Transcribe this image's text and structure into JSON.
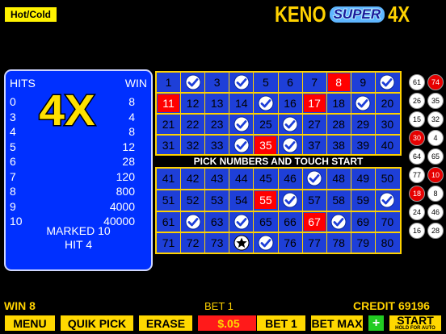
{
  "header": {
    "hotcold_label": "Hot/Cold",
    "logo": {
      "keno": "KENO",
      "super": "SUPER",
      "fx": "4X"
    }
  },
  "paytable": {
    "hits_label": "HITS",
    "win_label": "WIN",
    "badge": "4X",
    "rows": [
      {
        "hits": "0",
        "win": "8"
      },
      {
        "hits": "3",
        "win": "4"
      },
      {
        "hits": "4",
        "win": "8"
      },
      {
        "hits": "5",
        "win": "12"
      },
      {
        "hits": "6",
        "win": "28"
      },
      {
        "hits": "7",
        "win": "120"
      },
      {
        "hits": "8",
        "win": "800"
      },
      {
        "hits": "9",
        "win": "4000"
      },
      {
        "hits": "10",
        "win": "40000"
      }
    ],
    "marked_text": "MARKED 10",
    "hit_text": "HIT 4"
  },
  "board": {
    "pick_message": "PICK NUMBERS AND TOUCH START",
    "checked_numbers": [
      2,
      4,
      10,
      15,
      19,
      24,
      26,
      34,
      36,
      47,
      56,
      60,
      62,
      64,
      68,
      75
    ],
    "red_numbers": [
      8,
      11,
      17,
      35,
      55,
      67
    ],
    "star_numbers": [
      74
    ],
    "colors": {
      "board_bg": "#1e3fd8",
      "grid": "#ffd200",
      "hit_red": "#ff0000"
    }
  },
  "balls": [
    {
      "n": "61",
      "red": false
    },
    {
      "n": "74",
      "red": true
    },
    {
      "n": "26",
      "red": false
    },
    {
      "n": "35",
      "red": false
    },
    {
      "n": "15",
      "red": false
    },
    {
      "n": "32",
      "red": false
    },
    {
      "n": "30",
      "red": true
    },
    {
      "n": "4",
      "red": false
    },
    {
      "n": "64",
      "red": false
    },
    {
      "n": "65",
      "red": false
    },
    {
      "n": "77",
      "red": false
    },
    {
      "n": "10",
      "red": true
    },
    {
      "n": "18",
      "red": true
    },
    {
      "n": "8",
      "red": false
    },
    {
      "n": "24",
      "red": false
    },
    {
      "n": "46",
      "red": false
    },
    {
      "n": "16",
      "red": false
    },
    {
      "n": "28",
      "red": false
    }
  ],
  "status": {
    "win": "WIN 8",
    "bet": "BET 1",
    "credit": "CREDIT 69196"
  },
  "buttons": {
    "menu": "MENU",
    "quik_pick": "QUIK PICK",
    "erase": "ERASE",
    "bet_amount": "$.05",
    "bet_one": "BET 1",
    "bet_max": "BET MAX",
    "plus": "+",
    "start": "START",
    "start_sub": "HOLD FOR AUTO"
  }
}
